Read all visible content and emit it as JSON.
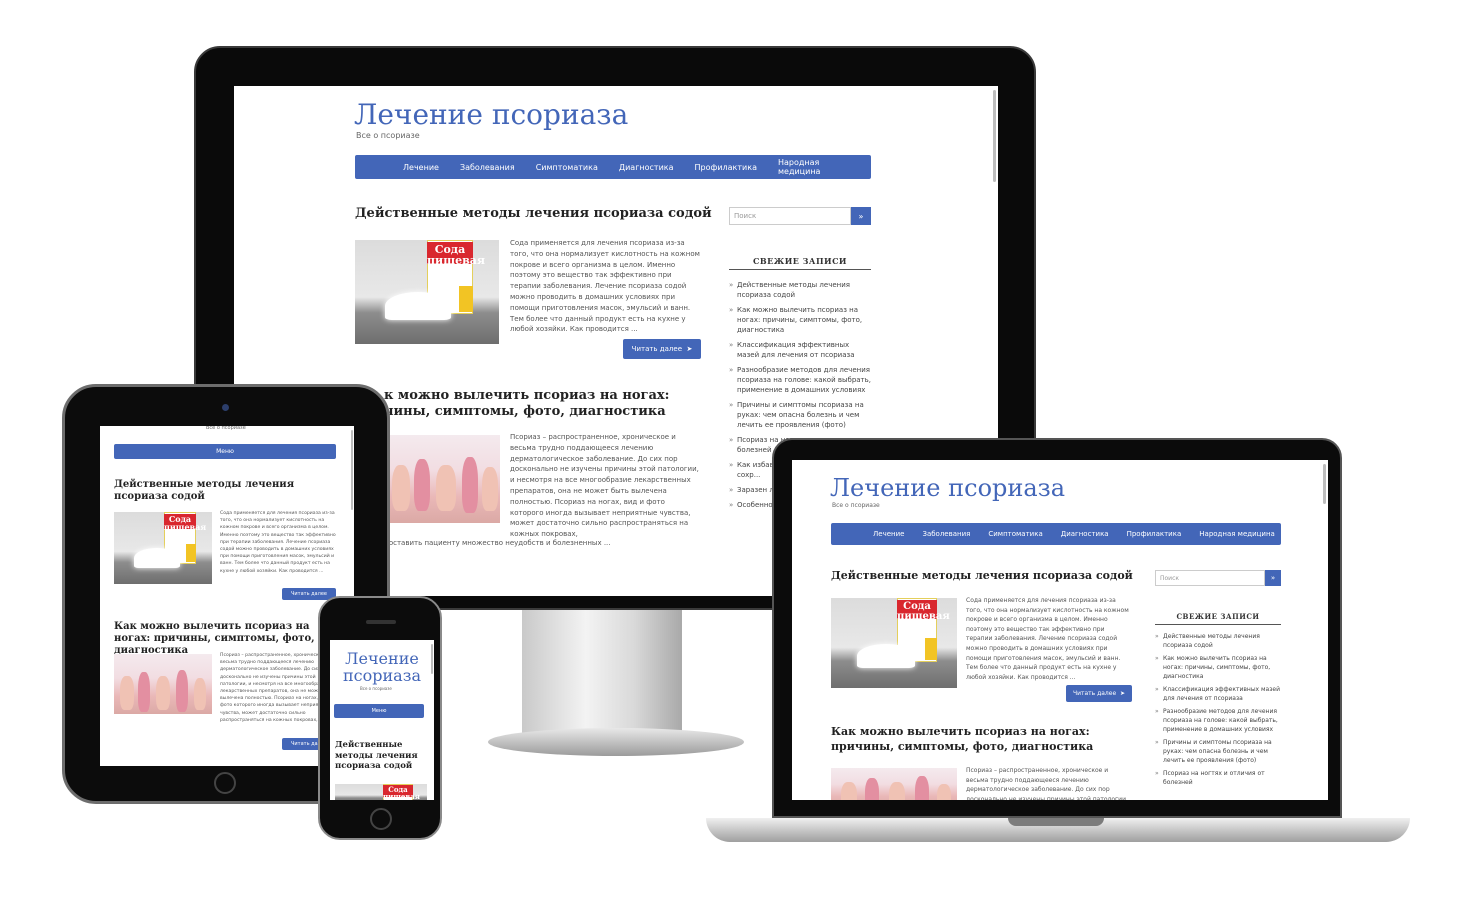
{
  "site": {
    "title": "Лечение псориаза",
    "title_line1": "Лечение",
    "title_line2": "псориаза",
    "tagline": "Все о псориазе",
    "nav": [
      "Лечение",
      "Заболевания",
      "Симптоматика",
      "Диагностика",
      "Профилактика",
      "Народная медицина"
    ],
    "menu_label": "Меню"
  },
  "posts": [
    {
      "title": "Действенные методы лечения псориаза содой",
      "excerpt": "Сода применяется для лечения псориаза из-за того, что она нормализует кислотность на кожном покрове и всего организма в целом. Именно поэтому это вещество так эффективно при терапии заболевания. Лечение псориаза содой можно проводить в домашних условиях при помощи приготовления масок, эмульсий и ванн. Тем более что данный продукт есть на кухне у любой хозяйки. Как проводится ...",
      "read_more": "Читать далее",
      "image_text": "Сода пищевая"
    },
    {
      "title": "Как можно вылечить псориаз на ногах: причины, симптомы, фото, диагностика",
      "title_partial": "к можно вылечить псориаз на ногах: чины, симптомы, фото, диагностика",
      "excerpt": "Псориаз – распространенное, хроническое и весьма трудно поддающееся лечению дерматологическое заболевание. До сих пор досконально не изучены причины этой патологии, и несмотря на все многообразие лекарственных препаратов, она не может быть вылечена полностью. Псориаз на ногах, вид и фото которого иногда вызывает неприятные чувства, может достаточно сильно распространяться на кожных покровах,",
      "excerpt_end": "доставить пациенту множество неудобств и болезненных ...",
      "read_more": "Читать далее"
    }
  ],
  "sidebar": {
    "search_placeholder": "Поиск",
    "search_button": "»",
    "widget_title": "СВЕЖИЕ ЗАПИСИ",
    "recent": [
      "Действенные методы лечения псориаза содой",
      "Как можно вылечить псориаз на ногах: причины, симптомы, фото, диагностика",
      "Классификация эффективных мазей для лечения от псориаза",
      "Разнообразие методов для лечения псориаза на голове: какой выбрать, применение в домашних условиях",
      "Причины и симптомы псориаза на руках: чем опасна болезнь и чем лечить ее проявления (фото)",
      "Псориаз на ногтях и отличия от болезней",
      "Как избавиться ... локтях, ... для сохр...",
      "Заразен ли ... защитить ... лишая",
      "Особенности ..."
    ]
  },
  "colors": {
    "brand": "#4366b8",
    "frame": "#0a0a0a"
  }
}
